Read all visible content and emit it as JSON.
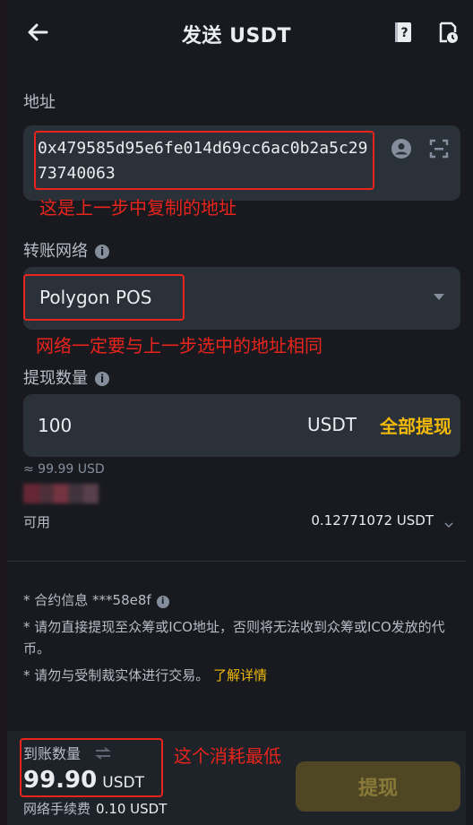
{
  "header": {
    "title": "发送 USDT",
    "back_icon": "arrow-left-icon",
    "help_icon": "help-book-icon",
    "history_icon": "history-doc-icon"
  },
  "address": {
    "label": "地址",
    "value": "0x479585d95e6fe014d69cc6ac0b2a5c2973740063",
    "contact_icon": "contact-icon",
    "scan_icon": "scan-icon"
  },
  "network": {
    "label": "转账网络",
    "value": "Polygon POS"
  },
  "amount": {
    "label": "提现数量",
    "value": "100",
    "unit": "USDT",
    "max_label": "全部提现",
    "approx": "≈ 99.99 USD"
  },
  "available": {
    "label": "可用",
    "value": "0.12771072 USDT"
  },
  "notes": {
    "contract": "* 合约信息 ***58e8f",
    "warning1": "* 请勿直接提现至众筹或ICO地址，否则将无法收到众筹或ICO发放的代币。",
    "warning2": "* 请勿与受制裁实体进行交易。",
    "link": "了解详情"
  },
  "footer": {
    "receive_label": "到账数量",
    "receive_value": "99.90",
    "receive_unit": "USDT",
    "fee_label": "网络手续费",
    "fee_value": "0.10 USDT",
    "withdraw_label": "提现"
  },
  "annotations": {
    "address_note": "这是上一步中复制的地址",
    "network_note": "网络一定要与上一步选中的地址相同",
    "receive_note": "这个消耗最低"
  },
  "colors": {
    "background": "#181a20",
    "field": "#2b3139",
    "accent": "#f0b90b",
    "annotation": "#e8241c"
  }
}
